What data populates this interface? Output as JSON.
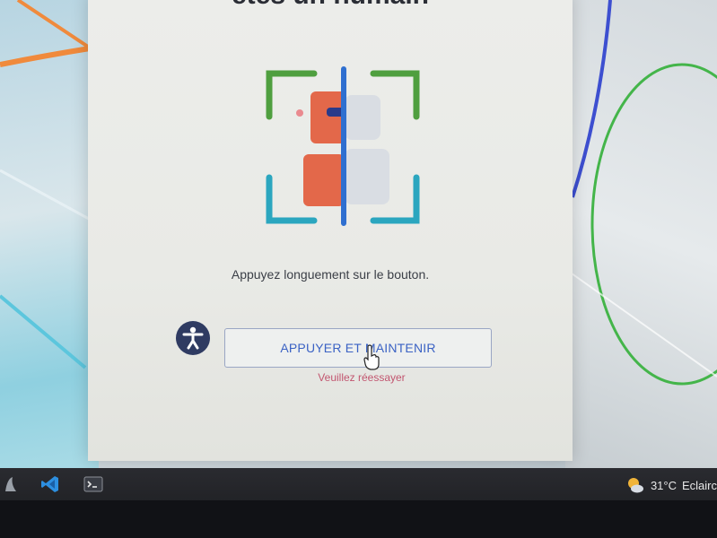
{
  "dialog": {
    "title": "etes un humain",
    "instruction": "Appuyez longuement sur le bouton.",
    "hold_button_label": "APPUYER ET MAINTENIR",
    "error_message": "Veuillez réessayer"
  },
  "taskbar": {
    "items": [
      "app-icon",
      "vscode-icon",
      "terminal-icon"
    ],
    "weather": {
      "temperature": "31°C",
      "condition": "Eclairc"
    }
  },
  "colors": {
    "accessibility_button": "#2f3b62",
    "hold_button_text": "#3b62c4",
    "error_text": "#c25670",
    "taskbar": "#2a2b30"
  }
}
